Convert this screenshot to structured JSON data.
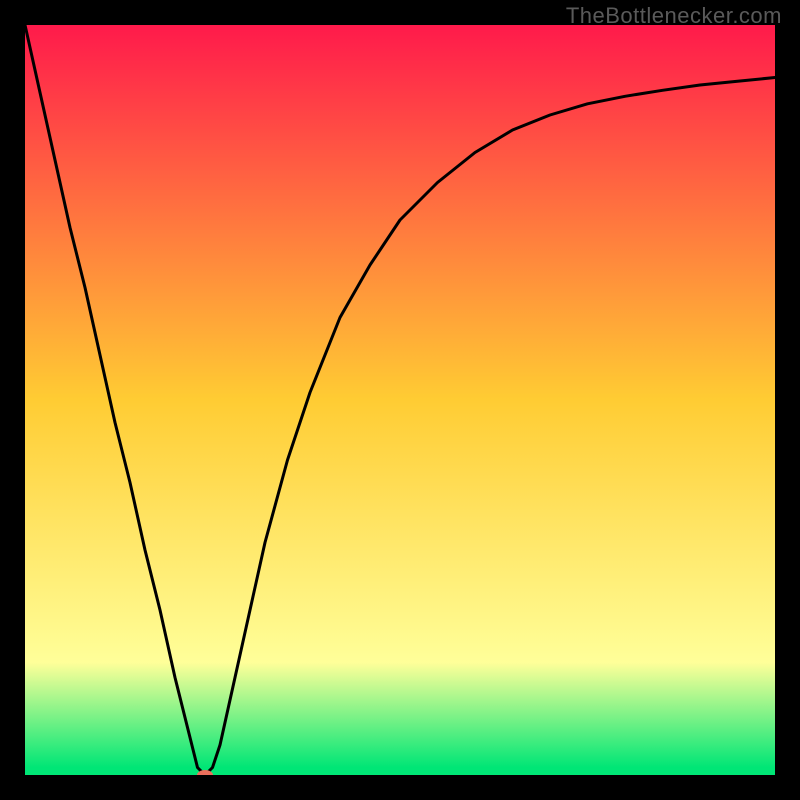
{
  "watermark": "TheBottlenecker.com",
  "colors": {
    "gradient_top": "#ff1a4b",
    "gradient_mid": "#ffcc33",
    "gradient_low": "#ffff99",
    "gradient_bottom": "#00e676",
    "curve": "#000000",
    "marker": "#eb6f5c",
    "outer_bg": "#000000"
  },
  "chart_data": {
    "type": "line",
    "title": "",
    "xlabel": "",
    "ylabel": "",
    "xlim": [
      0,
      100
    ],
    "ylim": [
      0,
      100
    ],
    "series": [
      {
        "name": "bottleneck-curve",
        "x": [
          0,
          2,
          4,
          6,
          8,
          10,
          12,
          14,
          16,
          18,
          20,
          22,
          23,
          24,
          25,
          26,
          28,
          30,
          32,
          35,
          38,
          42,
          46,
          50,
          55,
          60,
          65,
          70,
          75,
          80,
          85,
          90,
          95,
          100
        ],
        "values": [
          100,
          91,
          82,
          73,
          65,
          56,
          47,
          39,
          30,
          22,
          13,
          5,
          1,
          0,
          1,
          4,
          13,
          22,
          31,
          42,
          51,
          61,
          68,
          74,
          79,
          83,
          86,
          88,
          89.5,
          90.5,
          91.3,
          92,
          92.5,
          93
        ]
      }
    ],
    "marker": {
      "x": 24,
      "y": 0
    }
  }
}
